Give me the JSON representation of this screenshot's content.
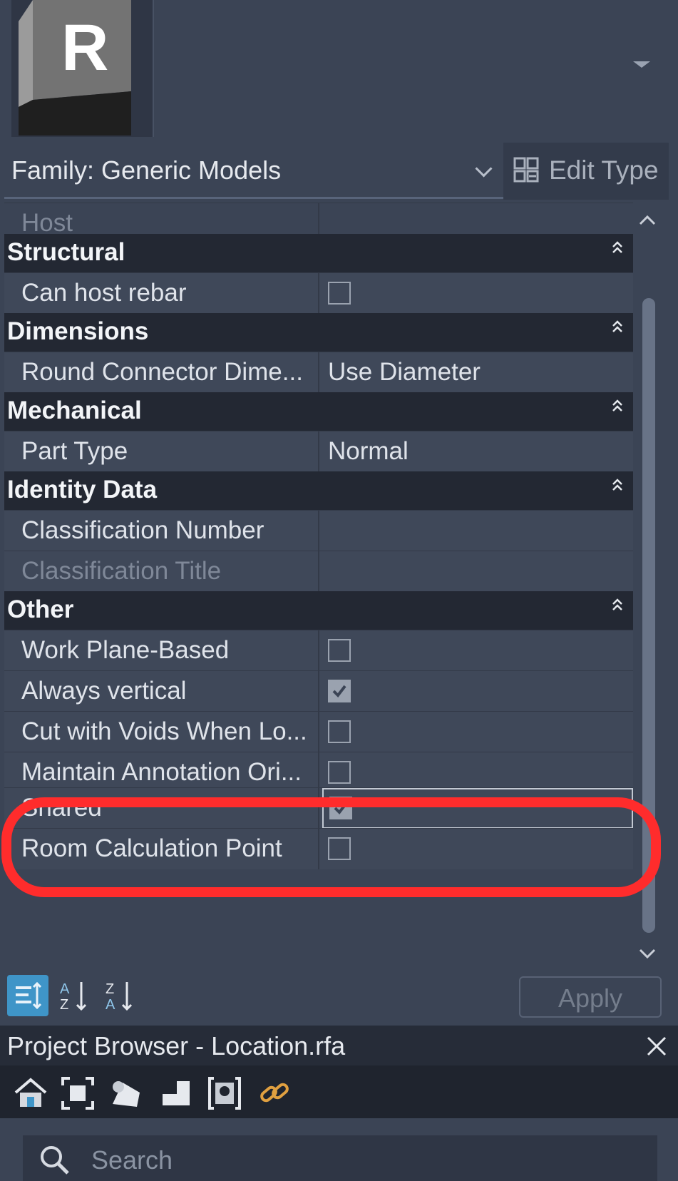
{
  "preview": {
    "logo_letter": "R"
  },
  "family": {
    "label": "Family: Generic Models"
  },
  "edit_type": {
    "label": "Edit Type"
  },
  "properties": {
    "host": {
      "name": "Host",
      "value": ""
    },
    "groups": [
      {
        "title": "Structural",
        "rows": [
          {
            "name": "Can host rebar",
            "checked": false
          }
        ]
      },
      {
        "title": "Dimensions",
        "rows": [
          {
            "name": "Round Connector Dime...",
            "value": "Use Diameter"
          }
        ]
      },
      {
        "title": "Mechanical",
        "rows": [
          {
            "name": "Part Type",
            "value": "Normal"
          }
        ]
      },
      {
        "title": "Identity Data",
        "rows": [
          {
            "name": "Classification Number",
            "value": ""
          },
          {
            "name": "Classification Title",
            "value": ""
          }
        ]
      },
      {
        "title": "Other",
        "rows": [
          {
            "name": "Work Plane-Based",
            "checked": false
          },
          {
            "name": "Always vertical",
            "checked": true
          },
          {
            "name": "Cut with Voids When Lo...",
            "checked": false
          },
          {
            "name": "Maintain Annotation Ori...",
            "checked": false
          },
          {
            "name": "Shared",
            "checked": true
          },
          {
            "name": "Room Calculation Point",
            "checked": false
          }
        ]
      }
    ]
  },
  "toolbar": {
    "apply_label": "Apply"
  },
  "project_browser": {
    "title": "Project Browser - Location.rfa"
  },
  "search": {
    "placeholder": "Search"
  },
  "colors": {
    "highlight": "#ff2c2c",
    "active_tool": "#3f95c8",
    "header_bg": "#232833"
  }
}
